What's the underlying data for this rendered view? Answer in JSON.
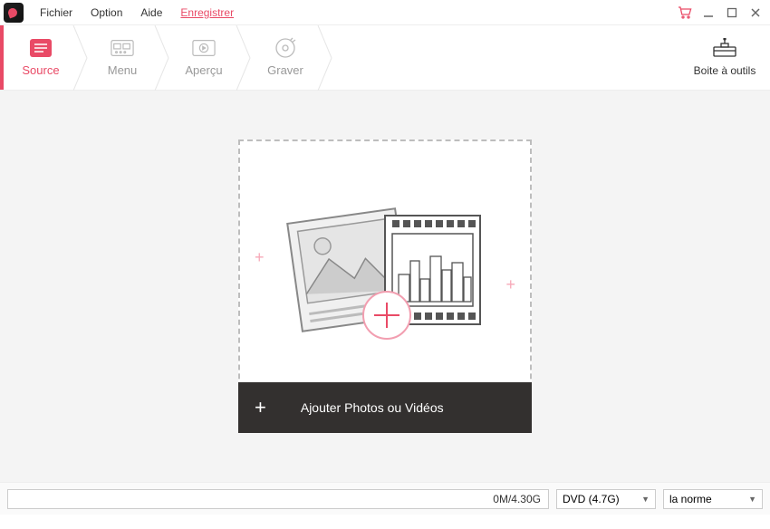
{
  "menu": {
    "file": "Fichier",
    "option": "Option",
    "help": "Aide",
    "register": "Enregistrer"
  },
  "steps": {
    "source": "Source",
    "menu": "Menu",
    "preview": "Aperçu",
    "burn": "Graver"
  },
  "toolbox": "Boite à outils",
  "dropzone": {
    "add_label": "Ajouter Photos ou Vidéos"
  },
  "bottom": {
    "size": "0M/4.30G",
    "disc_type": "DVD (4.7G)",
    "quality": "la norme"
  },
  "icons": {
    "cart": "cart-icon",
    "minimize": "minimize-icon",
    "maximize": "maximize-icon",
    "close": "close-icon"
  }
}
